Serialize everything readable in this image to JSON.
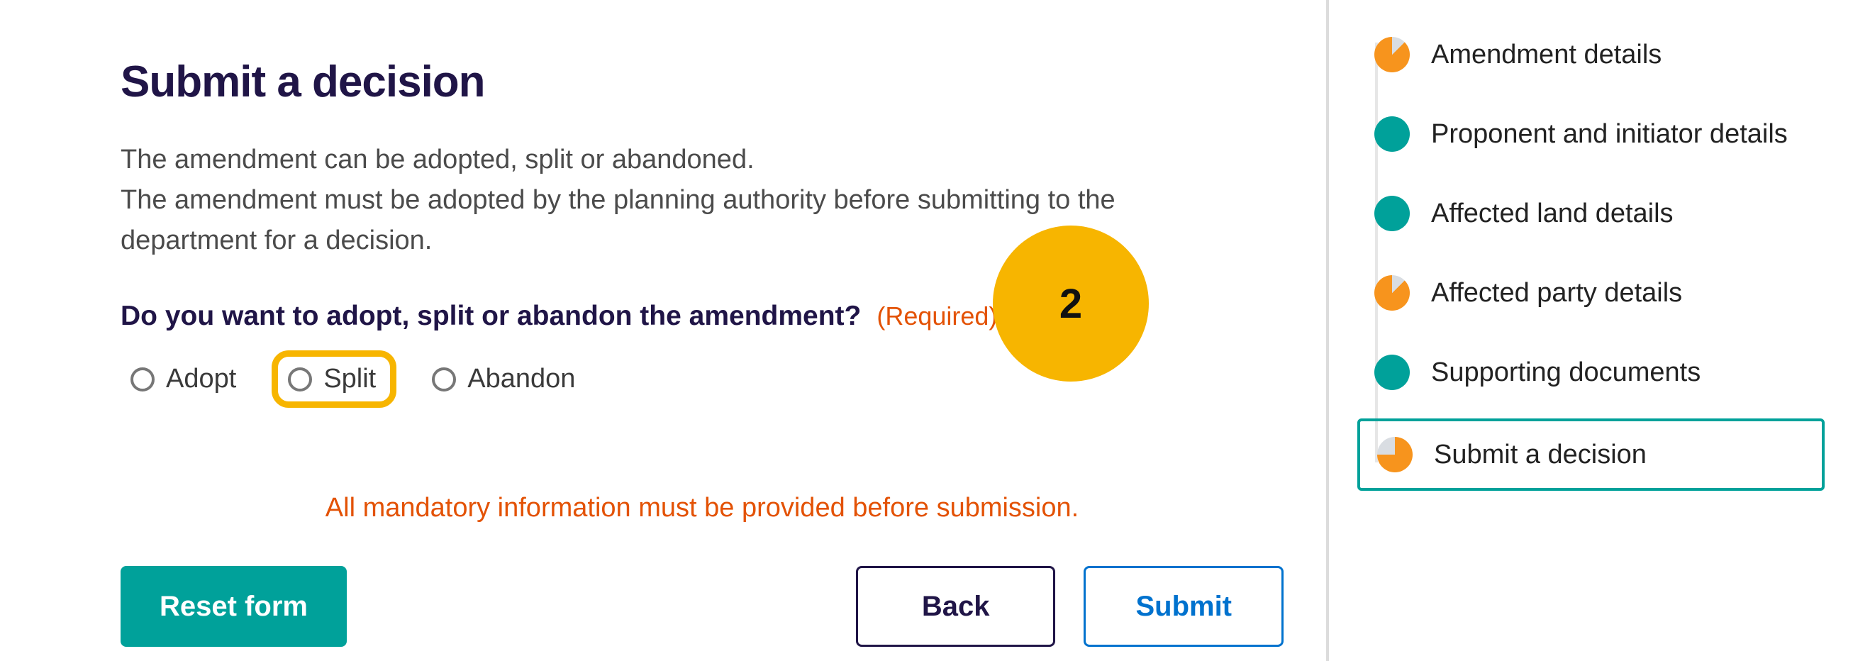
{
  "page": {
    "title": "Submit a decision",
    "intro_line1": "The amendment can be adopted, split or abandoned.",
    "intro_line2": "The amendment must be adopted by the planning authority before submitting to the department for a decision."
  },
  "question": {
    "text": "Do you want to adopt, split or abandon the amendment?",
    "required_label": "(Required)"
  },
  "options": {
    "adopt": "Adopt",
    "split": "Split",
    "abandon": "Abandon"
  },
  "callout": {
    "number": "2"
  },
  "warning": "All mandatory information must be provided before submission.",
  "buttons": {
    "reset": "Reset form",
    "back": "Back",
    "submit": "Submit"
  },
  "sidenav": {
    "steps": [
      {
        "label": "Amendment details",
        "state": "partial"
      },
      {
        "label": "Proponent and initiator details",
        "state": "complete"
      },
      {
        "label": "Affected land details",
        "state": "complete"
      },
      {
        "label": "Affected party details",
        "state": "partial"
      },
      {
        "label": "Supporting documents",
        "state": "complete"
      },
      {
        "label": "Submit a decision",
        "state": "current"
      }
    ]
  },
  "colors": {
    "brand_dark": "#201547",
    "teal": "#00a19a",
    "orange_warn": "#e35205",
    "orange_pie": "#f7941d",
    "yellow_highlight": "#f7b500",
    "blue_submit": "#0072ce"
  }
}
